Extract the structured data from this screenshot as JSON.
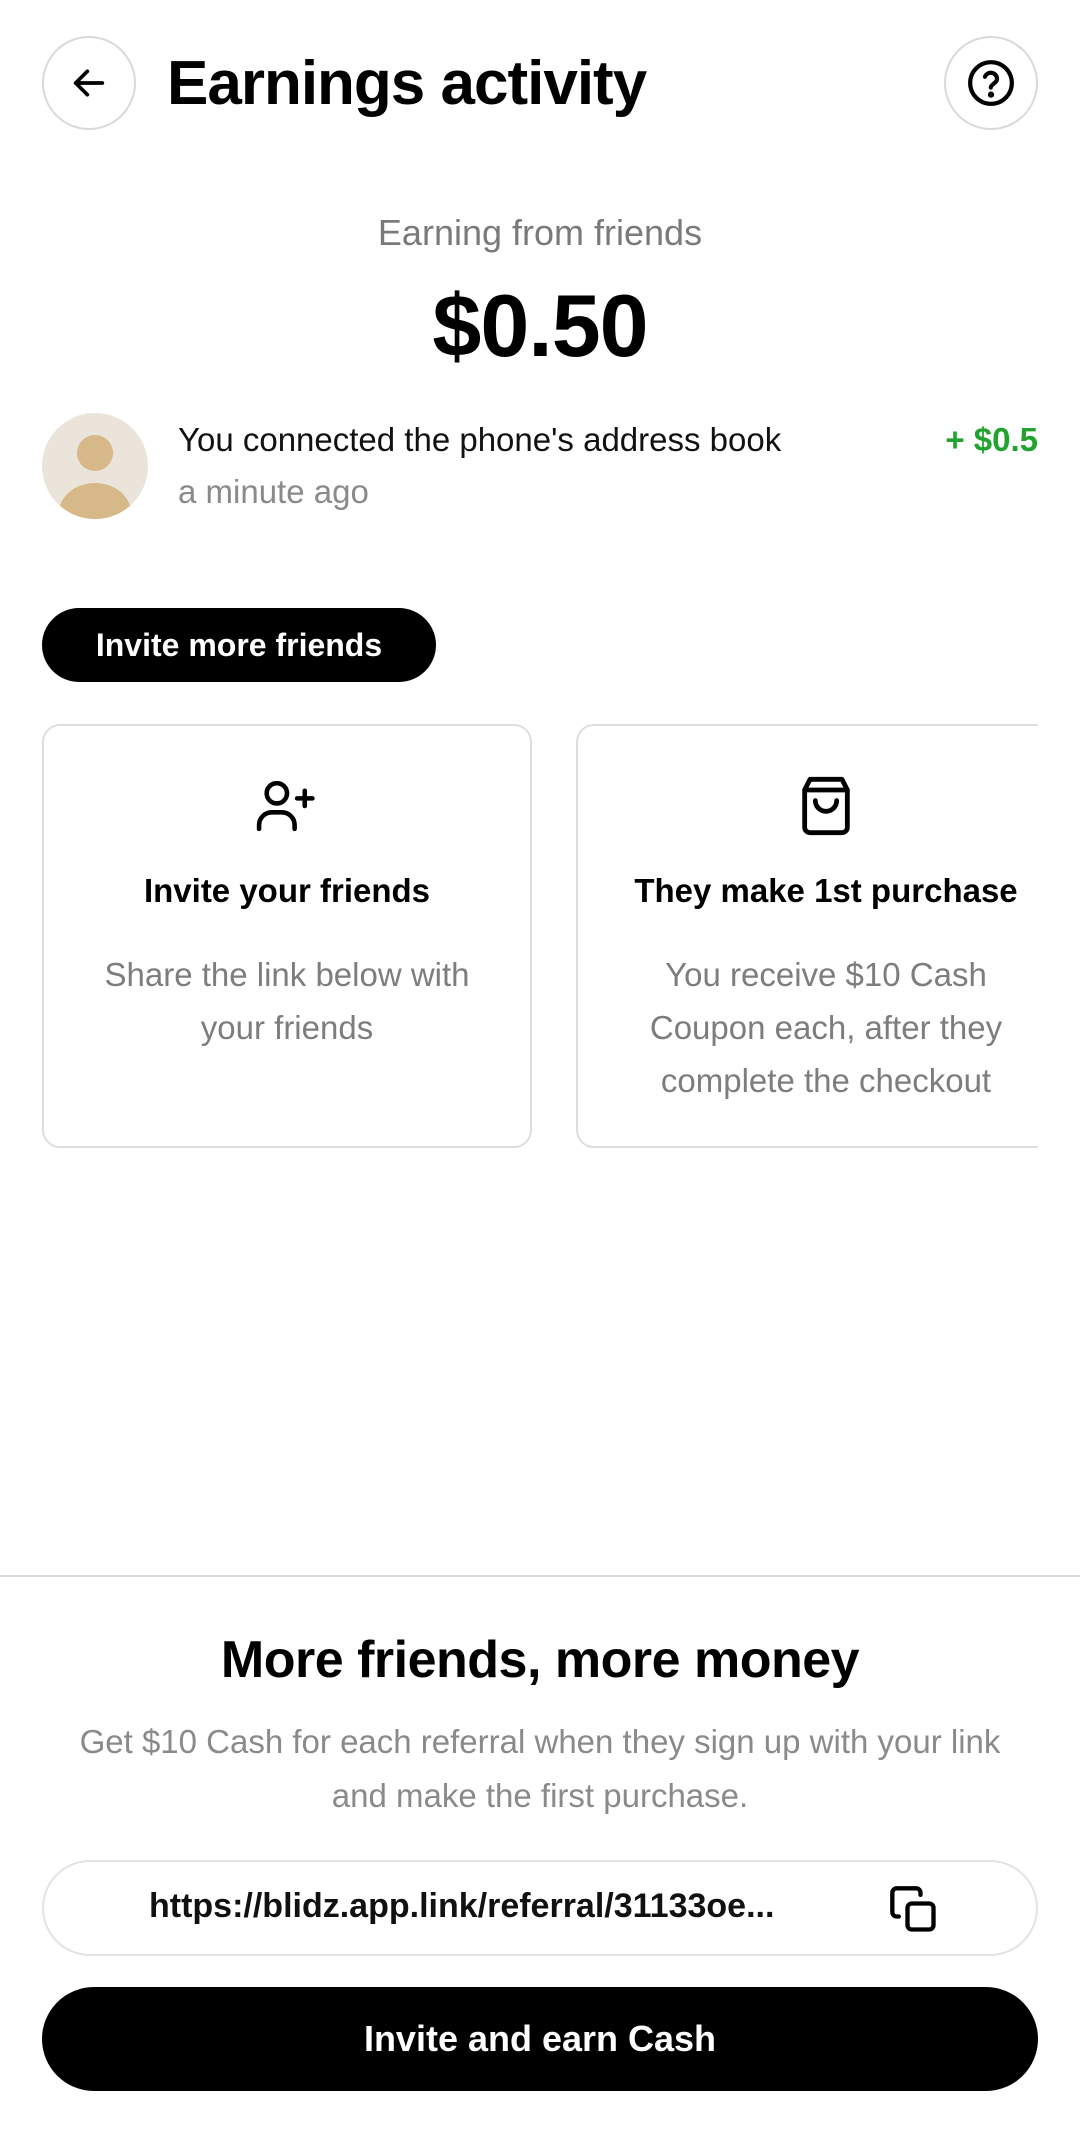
{
  "header": {
    "title": "Earnings activity",
    "back_icon": "arrow-left-icon",
    "help_icon": "question-circle-icon"
  },
  "summary": {
    "label": "Earning from friends",
    "amount": "$0.50"
  },
  "activity": {
    "items": [
      {
        "text": "You connected the phone's address book",
        "time": "a minute ago",
        "amount": "+ $0.5",
        "amount_color": "#22a32f"
      }
    ]
  },
  "invite_pill": {
    "label": "Invite more friends"
  },
  "cards": [
    {
      "icon": "user-plus-icon",
      "title": "Invite your friends",
      "desc": "Share the link below with your friends"
    },
    {
      "icon": "shopping-bag-icon",
      "title": "They make 1st purchase",
      "desc": "You receive $10 Cash Coupon each, after they complete the checkout"
    }
  ],
  "promo": {
    "title": "More friends, more money",
    "desc": "Get $10 Cash for each referral when they sign up with your link and make the first purchase."
  },
  "referral": {
    "link": "https://blidz.app.link/referral/31133oe...",
    "copy_icon": "copy-icon"
  },
  "cta": {
    "label": "Invite and earn Cash"
  }
}
